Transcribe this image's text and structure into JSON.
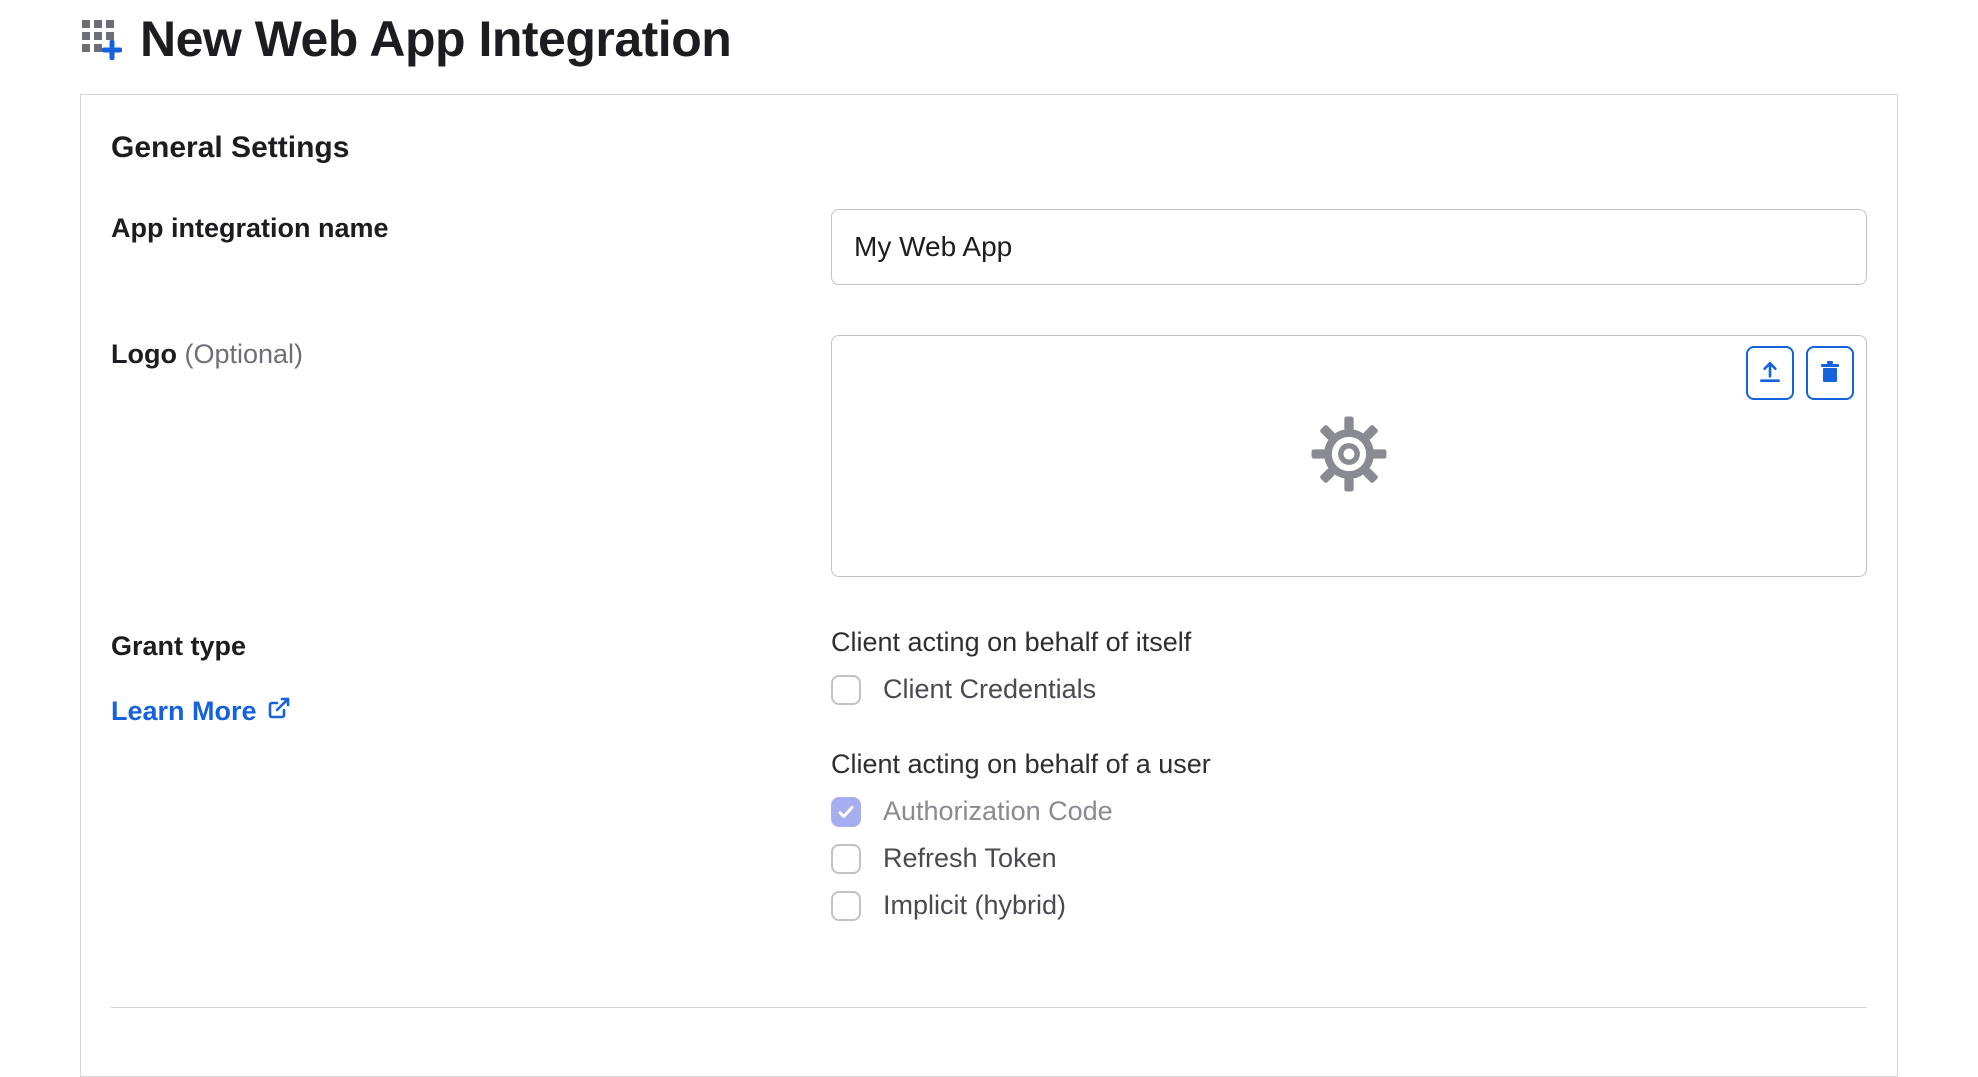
{
  "header": {
    "title": "New Web App Integration"
  },
  "general": {
    "section_title": "General Settings",
    "app_name": {
      "label": "App integration name",
      "value": "My Web App"
    },
    "logo": {
      "label": "Logo",
      "optional": " (Optional)"
    },
    "grant_type": {
      "label": "Grant type",
      "learn_more": "Learn More",
      "group_self": "Client acting on behalf of itself",
      "opt_client_credentials": {
        "label": "Client Credentials",
        "checked": false
      },
      "group_user": "Client acting on behalf of a user",
      "opt_auth_code": {
        "label": "Authorization Code",
        "checked": true,
        "disabled": true
      },
      "opt_refresh": {
        "label": "Refresh Token",
        "checked": false
      },
      "opt_implicit": {
        "label": "Implicit (hybrid)",
        "checked": false
      }
    }
  }
}
